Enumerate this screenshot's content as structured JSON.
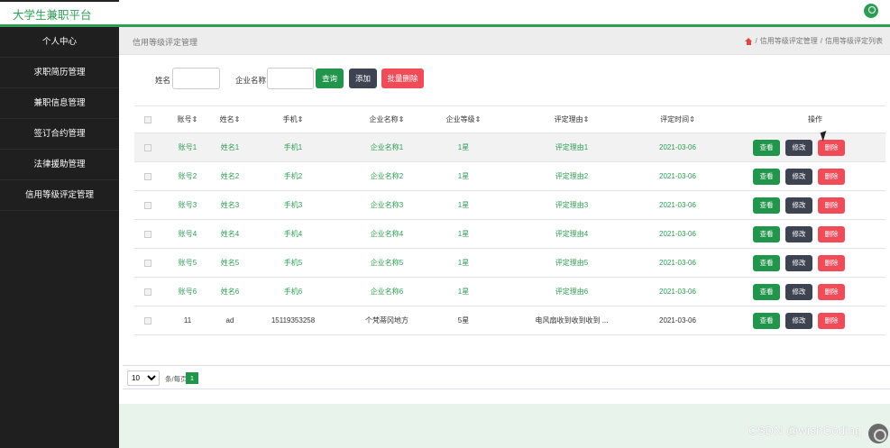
{
  "app": {
    "title": "大学生兼职平台"
  },
  "sidebar": {
    "items": [
      {
        "label": "个人中心"
      },
      {
        "label": "求职简历管理"
      },
      {
        "label": "兼职信息管理"
      },
      {
        "label": "签订合约管理"
      },
      {
        "label": "法律援助管理"
      },
      {
        "label": "信用等级评定管理"
      }
    ]
  },
  "breadcrumb": {
    "page_title": "信用等级评定管理",
    "sep1": "/",
    "crumb1": "信用等级评定管理",
    "sep2": "/",
    "crumb2": "信用等级评定列表"
  },
  "search": {
    "name_label": "姓名",
    "name_value": "",
    "company_label": "企业名称",
    "company_value": "",
    "query_button": "查询",
    "add_button": "添加",
    "batch_delete_button": "批量删除"
  },
  "table": {
    "headers": [
      "账号",
      "姓名",
      "手机",
      "企业名称",
      "企业等级",
      "评定理由",
      "评定时间",
      "操作"
    ],
    "actions": {
      "view": "查看",
      "edit": "修改",
      "delete": "删除"
    },
    "rows": [
      [
        "账号1",
        "姓名1",
        "手机1",
        "企业名称1",
        "1星",
        "评定理由1",
        "2021-03-06"
      ],
      [
        "账号2",
        "姓名2",
        "手机2",
        "企业名称2",
        "1星",
        "评定理由2",
        "2021-03-06"
      ],
      [
        "账号3",
        "姓名3",
        "手机3",
        "企业名称3",
        "1星",
        "评定理由3",
        "2021-03-06"
      ],
      [
        "账号4",
        "姓名4",
        "手机4",
        "企业名称4",
        "1星",
        "评定理由4",
        "2021-03-06"
      ],
      [
        "账号5",
        "姓名5",
        "手机5",
        "企业名称5",
        "1星",
        "评定理由5",
        "2021-03-06"
      ],
      [
        "账号6",
        "姓名6",
        "手机6",
        "企业名称6",
        "1星",
        "评定理由6",
        "2021-03-06"
      ],
      [
        "11",
        "ad",
        "15119353258",
        "个梵蒂冈地方",
        "5星",
        "电风扇收到收到收到 ...",
        "2021-03-06"
      ]
    ],
    "view_label_row4": "查看"
  },
  "pager": {
    "page_size": "10",
    "page_size_options": [
      "10"
    ],
    "per_page_label": "条/每页",
    "current_page": "1"
  },
  "watermark": "CSDN @wishCoding",
  "colors": {
    "accent": "#20954b",
    "dark": "#3e4352",
    "danger": "#f04b59",
    "sidebar": "#1f1f1f"
  }
}
